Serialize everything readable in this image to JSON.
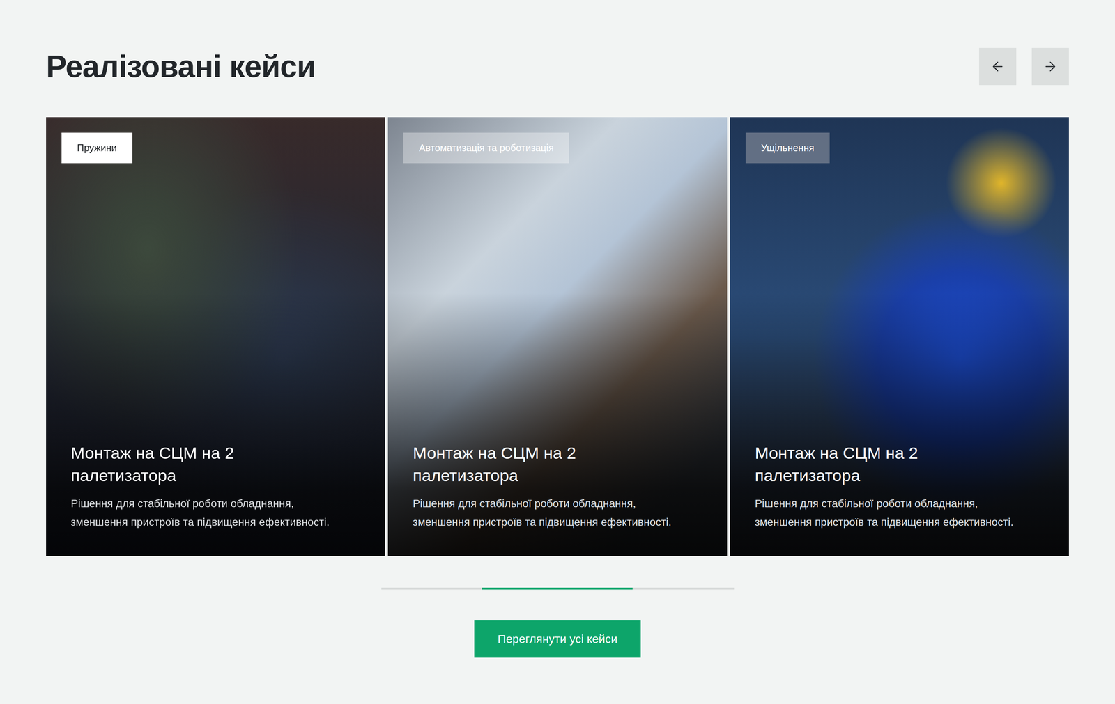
{
  "section": {
    "title": "Реалізовані кейси"
  },
  "nav": {
    "prev_disabled": false,
    "next_disabled": false
  },
  "cards": [
    {
      "tag": {
        "label": "Пружини",
        "kind": "solid"
      },
      "title": "Монтаж на СЦМ на 2 палетизатора",
      "description": "Рішення для стабільної роботи обладнання, зменшення пристроїв та підвищення ефективності.",
      "hovered": true
    },
    {
      "tag": {
        "label": "Автоматизація та роботизація",
        "kind": "glass"
      },
      "title": "Монтаж на СЦМ на 2 палетизатора",
      "description": "Рішення для стабільної роботи обладнання, зменшення пристроїв та підвищення ефективності.",
      "hovered": false
    },
    {
      "tag": {
        "label": "Ущільнення",
        "kind": "dark"
      },
      "title": "Монтаж на СЦМ на 2 палетизатора",
      "description": "Рішення для стабільної роботи обладнання, зменшення пристроїв та підвищення ефективності.",
      "hovered": false
    }
  ],
  "scrollbar": {
    "offset": 0.286,
    "level": 0.427
  },
  "button": {
    "label": "Переглянути усі кейси"
  }
}
